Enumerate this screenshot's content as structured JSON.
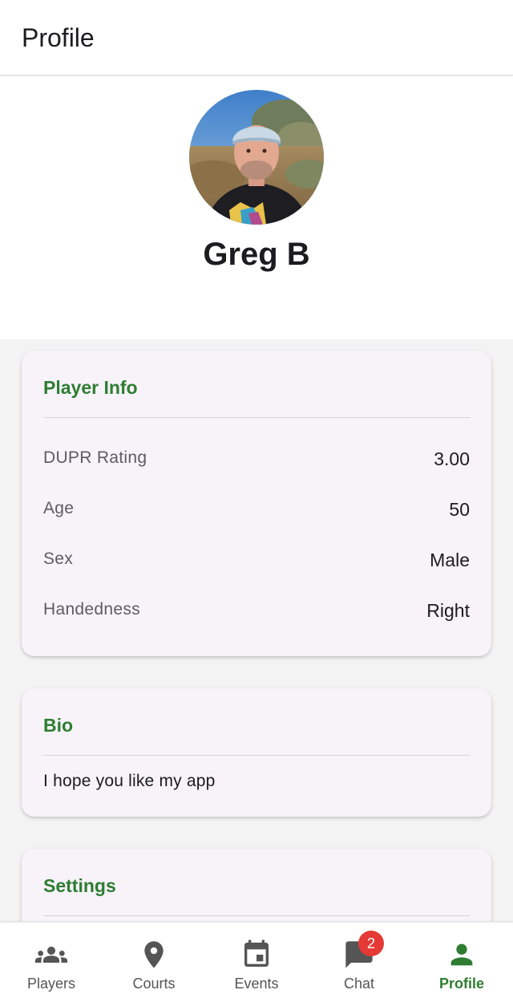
{
  "app_bar": {
    "title": "Profile"
  },
  "profile": {
    "name": "Greg B",
    "avatar_icon": "user-photo"
  },
  "player_info": {
    "title": "Player Info",
    "rows": [
      {
        "label": "DUPR Rating",
        "value": "3.00"
      },
      {
        "label": "Age",
        "value": "50"
      },
      {
        "label": "Sex",
        "value": "Male"
      },
      {
        "label": "Handedness",
        "value": "Right"
      }
    ]
  },
  "bio": {
    "title": "Bio",
    "text": "I hope you like my app"
  },
  "settings": {
    "title": "Settings"
  },
  "bottom_nav": {
    "items": [
      {
        "label": "Players",
        "icon": "group-icon"
      },
      {
        "label": "Courts",
        "icon": "location-pin-icon"
      },
      {
        "label": "Events",
        "icon": "calendar-icon"
      },
      {
        "label": "Chat",
        "icon": "chat-bubble-icon",
        "badge": "2"
      },
      {
        "label": "Profile",
        "icon": "person-icon",
        "active": true
      }
    ]
  },
  "colors": {
    "accent": "#2e7d32",
    "card_background": "#f7f3f9",
    "badge": "#e53935"
  }
}
